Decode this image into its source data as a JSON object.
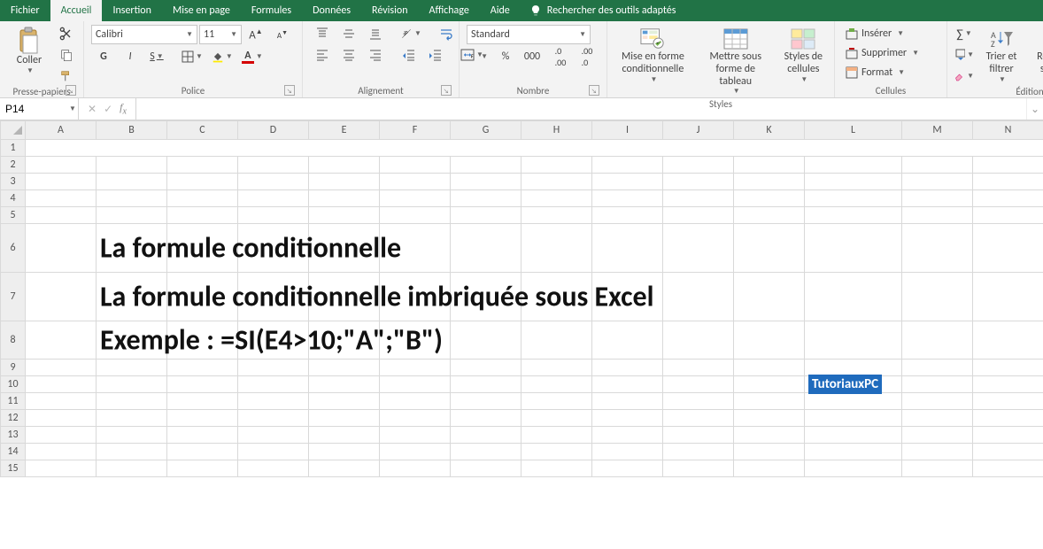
{
  "tabs": {
    "items": [
      "Fichier",
      "Accueil",
      "Insertion",
      "Mise en page",
      "Formules",
      "Données",
      "Révision",
      "Affichage",
      "Aide"
    ],
    "active": "Accueil",
    "search": "Rechercher des outils adaptés"
  },
  "ribbon": {
    "clipboard": {
      "paste": "Coller",
      "label": "Presse-papiers"
    },
    "font": {
      "name": "Calibri",
      "size": "11",
      "bold": "G",
      "italic": "I",
      "underline": "S",
      "label": "Police"
    },
    "align": {
      "label": "Alignement"
    },
    "number": {
      "format": "Standard",
      "pct": "%",
      "thou": "000",
      "label": "Nombre"
    },
    "styles": {
      "conditional": "Mise en forme conditionnelle",
      "table": "Mettre sous forme de tableau",
      "cell": "Styles de cellules",
      "label": "Styles"
    },
    "cells": {
      "insert": "Insérer",
      "delete": "Supprimer",
      "format": "Format",
      "label": "Cellules"
    },
    "editing": {
      "sort": "Trier et filtrer",
      "find": "Rechercher et sélectionner",
      "label": "Édition"
    }
  },
  "namebox": "P14",
  "columns": [
    "A",
    "B",
    "C",
    "D",
    "E",
    "F",
    "G",
    "H",
    "I",
    "J",
    "K",
    "L",
    "M",
    "N"
  ],
  "cells": {
    "B6": "La formule conditionnelle",
    "B7": "La formule conditionnelle imbriquée sous Excel",
    "B8": "Exemple : =SI(E4>10;\"A\";\"B\")",
    "L10": "TutoriauxPC"
  }
}
